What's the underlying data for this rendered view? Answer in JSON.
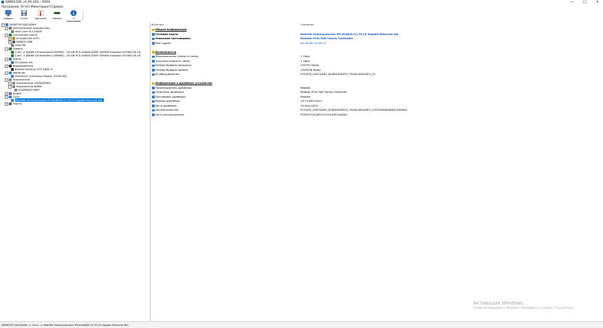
{
  "window": {
    "title": "SIW64.EXE v4.XX.XXX - XXXX",
    "buttons": [
      "—",
      "□",
      "✕"
    ]
  },
  "menu": [
    "Программа",
    "Отчёт",
    "Мониторинг",
    "Справка"
  ],
  "toolbar": [
    {
      "label": "Сводка",
      "icon": "monitor-icon"
    },
    {
      "label": "Отчёт",
      "icon": "save-icon"
    },
    {
      "label": "Датчики",
      "icon": "thermometer-icon"
    },
    {
      "label": "Память",
      "icon": "memory-icon"
    },
    {
      "label": "О программе",
      "icon": "info-icon"
    }
  ],
  "tree": [
    {
      "indent": 0,
      "label": "DESKTOP-QXCXD9H",
      "exp": "-",
      "icon": "computer-icon"
    },
    {
      "indent": 1,
      "label": "Центральные процессоры",
      "exp": "-",
      "icon": "cpu-icon"
    },
    {
      "indent": 2,
      "label": "Intel Core i5-14400F",
      "exp": "",
      "icon": "chip-icon"
    },
    {
      "indent": 1,
      "label": "Системная плата",
      "exp": "-",
      "icon": "board-icon"
    },
    {
      "indent": 2,
      "label": "Устройства ACPI",
      "exp": "+",
      "icon": "acpi-icon"
    },
    {
      "indent": 2,
      "label": "SMBIOS DMI",
      "exp": "+",
      "icon": "bios-icon"
    },
    {
      "indent": 2,
      "label": "Intel ME",
      "exp": "",
      "icon": "chip-icon"
    },
    {
      "indent": 1,
      "label": "Память",
      "exp": "-",
      "icon": "memory-icon"
    },
    {
      "indent": 2,
      "label": "Слот: 0 [BANK 0/Controller0-DIMM0] - 16 GB PC5-44800 DDR5 SDRAM Kingston KF560C30-16",
      "exp": "",
      "icon": "memory-icon"
    },
    {
      "indent": 2,
      "label": "Слот: 2 [BANK 0/Controller1-DIMM0] - 16 GB PC5-44800 DDR5 SDRAM Kingston KF560C30-16",
      "exp": "",
      "icon": "memory-icon"
    },
    {
      "indent": 1,
      "label": "Шины",
      "exp": "-",
      "icon": "bus-icon"
    },
    {
      "indent": 2,
      "label": "PCI Шина #0",
      "exp": "",
      "icon": "bus-icon"
    },
    {
      "indent": 1,
      "label": "Видеоадаптер",
      "exp": "-",
      "icon": "gpu-icon"
    },
    {
      "indent": 2,
      "label": "NVIDIA GeForce RTX 4060 Ti",
      "exp": "",
      "icon": "gpu-icon"
    },
    {
      "indent": 1,
      "label": "Монитор",
      "exp": "-",
      "icon": "monitor-icon"
    },
    {
      "indent": 2,
      "label": "ViewSonic [Unknown Model: VSC8C08]",
      "exp": "",
      "icon": "monitor-icon"
    },
    {
      "indent": 1,
      "label": "Накопители",
      "exp": "-",
      "icon": "drive-icon"
    },
    {
      "indent": 2,
      "label": "Накопители (SATA/ATAPI)",
      "exp": "-",
      "icon": "drive-icon"
    },
    {
      "indent": 2,
      "label": "Накопители NVMe",
      "exp": "-",
      "icon": "drive-icon"
    },
    {
      "indent": 3,
      "label": "DGSPNQ0T58PT",
      "exp": "",
      "icon": "drive-icon"
    },
    {
      "indent": 1,
      "label": "Аудио",
      "exp": "+",
      "icon": "audio-icon"
    },
    {
      "indent": 1,
      "label": "Сеть",
      "exp": "-",
      "icon": "network-icon"
    },
    {
      "indent": 2,
      "label": "RealTek Semiconductor RTL8168/8111 PCI-E Gigabit Ethernet NIC",
      "exp": "",
      "icon": "network-icon",
      "selected": true
    },
    {
      "indent": 1,
      "label": "Порты",
      "exp": "+",
      "icon": "port-icon"
    }
  ],
  "columns": {
    "field": "Функция",
    "value": "Описание"
  },
  "props": [
    {
      "type": "section",
      "field": "Общая информация",
      "value": "",
      "icon": "info-small-icon"
    },
    {
      "type": "bold-blue",
      "field": "Сетевая карта:",
      "value": "RealTek Semiconductor RTL8168/8111 PCI-E Gigabit Ethernet NIC",
      "icon": "nic-icon"
    },
    {
      "type": "bold-blue",
      "field": "Описание поставщика:",
      "value": "Realtek PCIe GbE Family Controller",
      "icon": "nic-icon"
    },
    {
      "type": "link",
      "field": "MAC-адрес:",
      "value": "84-56-60-79-4B-C0",
      "icon": "nic-icon"
    },
    {
      "type": "gap",
      "field": "",
      "value": "",
      "icon": ""
    },
    {
      "type": "section",
      "field": "Возможности",
      "value": "",
      "icon": "info-small-icon"
    },
    {
      "type": "",
      "field": "Максимальная скорость связи",
      "value": "1 Gbps",
      "icon": "nic-icon"
    },
    {
      "type": "",
      "field": "Текущая скорость связи",
      "value": "1 Gbps",
      "icon": "nic-icon"
    },
    {
      "type": "",
      "field": "Размер буфера передачи",
      "value": "259792 Bytes",
      "icon": "nic-icon"
    },
    {
      "type": "",
      "field": "Размер буфера приёма",
      "value": "1559536 Bytes",
      "icon": "nic-icon"
    },
    {
      "type": "",
      "field": "ID оборудования:",
      "value": "PCI\\VEN_10EC&DEV_8168&SUBSYS_7D481462&REV_15",
      "icon": "nic-icon"
    },
    {
      "type": "gap",
      "field": "",
      "value": "",
      "icon": ""
    },
    {
      "type": "section",
      "field": "Информация о драйвере устройства",
      "value": "",
      "icon": "info-small-icon"
    },
    {
      "type": "",
      "field": "Производитель драйвера",
      "value": "Realtek",
      "icon": "nic-icon"
    },
    {
      "type": "",
      "field": "Описание драйвера",
      "value": "Realtek PCIe GbE Family Controller",
      "icon": "nic-icon"
    },
    {
      "type": "",
      "field": "Поставщик драйвера",
      "value": "Realtek",
      "icon": "nic-icon"
    },
    {
      "type": "",
      "field": "Версия драйвера",
      "value": "10.73.605.2024",
      "icon": "nic-icon"
    },
    {
      "type": "",
      "field": "Дата драйвера",
      "value": "15-Aug-2024",
      "icon": "nic-icon"
    },
    {
      "type": "",
      "field": "DeviceInstanceId",
      "value": "PCI\\VEN_10EC&DEV_8168&SUBSYS_7D481462&REV_15\\01000000684CE00000",
      "icon": "nic-icon"
    },
    {
      "type": "",
      "field": "Путь расположения",
      "value": "PCIROOT(0)#PCI(1C03)#PCI(0000)",
      "icon": "nic-icon"
    }
  ],
  "statusbar": "DESKTOP-QXCXD9H -> Сеть -> RealTek Semiconductor RTL8168/8111 PCI-E Gigabit Ethernet NIC",
  "watermark": {
    "line1": "Активация Windows",
    "line2": "Чтобы активировать Windows, перейдите в раздел \"Параметры\"."
  }
}
